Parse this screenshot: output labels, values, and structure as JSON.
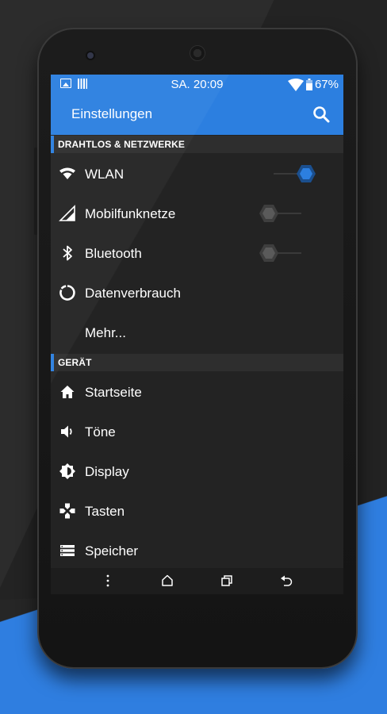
{
  "colors": {
    "accent": "#2c7fe0",
    "background": "#232323",
    "section_bg": "#2e2e2e",
    "toggle_off": "#555555"
  },
  "status_bar": {
    "time": "SA. 20:09",
    "battery": "67%",
    "left_icons": [
      "image-icon",
      "sim-card-icon"
    ],
    "right_icons": [
      "wifi-signal-icon",
      "battery-icon"
    ]
  },
  "app_bar": {
    "title": "Einstellungen",
    "icon": "search-icon"
  },
  "sections": [
    {
      "header": "DRAHTLOS & NETZWERKE",
      "items": [
        {
          "label": "WLAN",
          "icon": "wifi-icon",
          "toggle": true
        },
        {
          "label": "Mobilfunknetze",
          "icon": "signal-icon",
          "toggle": false
        },
        {
          "label": "Bluetooth",
          "icon": "bluetooth-icon",
          "toggle": false
        },
        {
          "label": "Datenverbrauch",
          "icon": "data-usage-icon"
        },
        {
          "label": "Mehr..."
        }
      ]
    },
    {
      "header": "GERÄT",
      "items": [
        {
          "label": "Startseite",
          "icon": "home-icon"
        },
        {
          "label": "Töne",
          "icon": "volume-icon"
        },
        {
          "label": "Display",
          "icon": "brightness-icon"
        },
        {
          "label": "Tasten",
          "icon": "gamepad-icon"
        },
        {
          "label": "Speicher",
          "icon": "storage-icon"
        }
      ]
    }
  ],
  "nav_bar": {
    "buttons": [
      "menu-icon",
      "home-icon",
      "recents-icon",
      "back-icon"
    ]
  }
}
